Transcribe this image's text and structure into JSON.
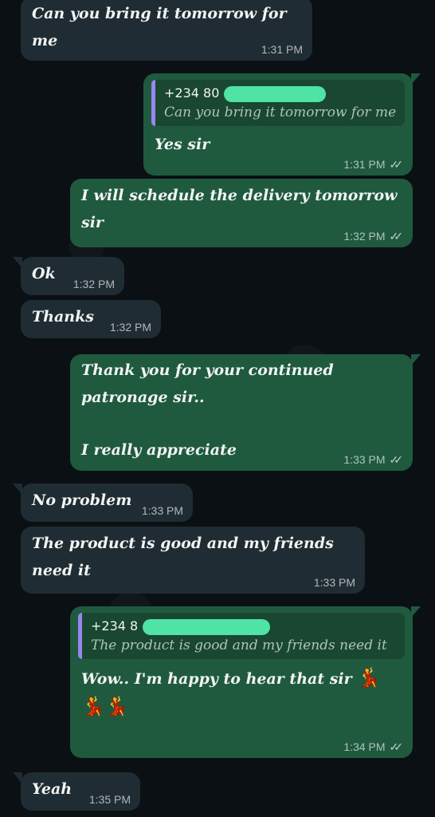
{
  "messages": [
    {
      "text": "Can you bring it tomorrow for me",
      "time": "1:31 PM"
    },
    {
      "quote_name": "+234 80",
      "quote_text": "Can you bring it tomorrow for me",
      "text": "Yes sir",
      "time": "1:31 PM"
    },
    {
      "line1": "I will schedule the delivery tomorrow",
      "line2": "sir",
      "time": "1:32 PM"
    },
    {
      "text": "Ok",
      "time": "1:32 PM"
    },
    {
      "text": "Thanks",
      "time": "1:32 PM"
    },
    {
      "line1": "Thank you for your continued",
      "line2": "patronage sir..",
      "line3": "I really appreciate",
      "time": "1:33 PM"
    },
    {
      "text": "No problem",
      "time": "1:33 PM"
    },
    {
      "line1": "The product is good and my friends",
      "line2": "need it",
      "time": "1:33 PM"
    },
    {
      "quote_name": "+234 8",
      "quote_text": "The product is good and my friends need it",
      "text": "Wow.. I'm happy to hear that sir",
      "emoji": "💃",
      "emoji2": "💃💃",
      "time": "1:34 PM"
    },
    {
      "text": "Yeah",
      "time": "1:35 PM"
    }
  ],
  "icons": {
    "read_receipt": "double-check-icon",
    "dancer": "dancer-emoji"
  },
  "colors": {
    "incoming": "#202c33",
    "outgoing": "#1f5a3f",
    "quote_bar": "#9b85ef",
    "redaction": "#4fe3a6"
  }
}
